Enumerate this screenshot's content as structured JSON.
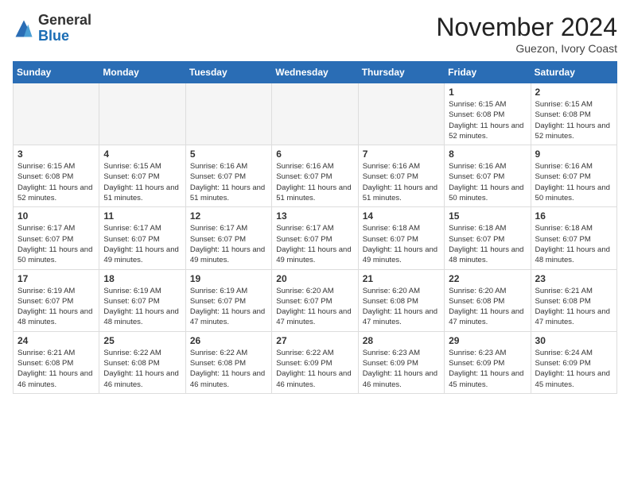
{
  "header": {
    "logo_general": "General",
    "logo_blue": "Blue",
    "month_title": "November 2024",
    "subtitle": "Guezon, Ivory Coast"
  },
  "weekdays": [
    "Sunday",
    "Monday",
    "Tuesday",
    "Wednesday",
    "Thursday",
    "Friday",
    "Saturday"
  ],
  "weeks": [
    [
      {
        "day": "",
        "empty": true
      },
      {
        "day": "",
        "empty": true
      },
      {
        "day": "",
        "empty": true
      },
      {
        "day": "",
        "empty": true
      },
      {
        "day": "",
        "empty": true
      },
      {
        "day": "1",
        "sunrise": "Sunrise: 6:15 AM",
        "sunset": "Sunset: 6:08 PM",
        "daylight": "Daylight: 11 hours and 52 minutes."
      },
      {
        "day": "2",
        "sunrise": "Sunrise: 6:15 AM",
        "sunset": "Sunset: 6:08 PM",
        "daylight": "Daylight: 11 hours and 52 minutes."
      }
    ],
    [
      {
        "day": "3",
        "sunrise": "Sunrise: 6:15 AM",
        "sunset": "Sunset: 6:08 PM",
        "daylight": "Daylight: 11 hours and 52 minutes."
      },
      {
        "day": "4",
        "sunrise": "Sunrise: 6:15 AM",
        "sunset": "Sunset: 6:07 PM",
        "daylight": "Daylight: 11 hours and 51 minutes."
      },
      {
        "day": "5",
        "sunrise": "Sunrise: 6:16 AM",
        "sunset": "Sunset: 6:07 PM",
        "daylight": "Daylight: 11 hours and 51 minutes."
      },
      {
        "day": "6",
        "sunrise": "Sunrise: 6:16 AM",
        "sunset": "Sunset: 6:07 PM",
        "daylight": "Daylight: 11 hours and 51 minutes."
      },
      {
        "day": "7",
        "sunrise": "Sunrise: 6:16 AM",
        "sunset": "Sunset: 6:07 PM",
        "daylight": "Daylight: 11 hours and 51 minutes."
      },
      {
        "day": "8",
        "sunrise": "Sunrise: 6:16 AM",
        "sunset": "Sunset: 6:07 PM",
        "daylight": "Daylight: 11 hours and 50 minutes."
      },
      {
        "day": "9",
        "sunrise": "Sunrise: 6:16 AM",
        "sunset": "Sunset: 6:07 PM",
        "daylight": "Daylight: 11 hours and 50 minutes."
      }
    ],
    [
      {
        "day": "10",
        "sunrise": "Sunrise: 6:17 AM",
        "sunset": "Sunset: 6:07 PM",
        "daylight": "Daylight: 11 hours and 50 minutes."
      },
      {
        "day": "11",
        "sunrise": "Sunrise: 6:17 AM",
        "sunset": "Sunset: 6:07 PM",
        "daylight": "Daylight: 11 hours and 49 minutes."
      },
      {
        "day": "12",
        "sunrise": "Sunrise: 6:17 AM",
        "sunset": "Sunset: 6:07 PM",
        "daylight": "Daylight: 11 hours and 49 minutes."
      },
      {
        "day": "13",
        "sunrise": "Sunrise: 6:17 AM",
        "sunset": "Sunset: 6:07 PM",
        "daylight": "Daylight: 11 hours and 49 minutes."
      },
      {
        "day": "14",
        "sunrise": "Sunrise: 6:18 AM",
        "sunset": "Sunset: 6:07 PM",
        "daylight": "Daylight: 11 hours and 49 minutes."
      },
      {
        "day": "15",
        "sunrise": "Sunrise: 6:18 AM",
        "sunset": "Sunset: 6:07 PM",
        "daylight": "Daylight: 11 hours and 48 minutes."
      },
      {
        "day": "16",
        "sunrise": "Sunrise: 6:18 AM",
        "sunset": "Sunset: 6:07 PM",
        "daylight": "Daylight: 11 hours and 48 minutes."
      }
    ],
    [
      {
        "day": "17",
        "sunrise": "Sunrise: 6:19 AM",
        "sunset": "Sunset: 6:07 PM",
        "daylight": "Daylight: 11 hours and 48 minutes."
      },
      {
        "day": "18",
        "sunrise": "Sunrise: 6:19 AM",
        "sunset": "Sunset: 6:07 PM",
        "daylight": "Daylight: 11 hours and 48 minutes."
      },
      {
        "day": "19",
        "sunrise": "Sunrise: 6:19 AM",
        "sunset": "Sunset: 6:07 PM",
        "daylight": "Daylight: 11 hours and 47 minutes."
      },
      {
        "day": "20",
        "sunrise": "Sunrise: 6:20 AM",
        "sunset": "Sunset: 6:07 PM",
        "daylight": "Daylight: 11 hours and 47 minutes."
      },
      {
        "day": "21",
        "sunrise": "Sunrise: 6:20 AM",
        "sunset": "Sunset: 6:08 PM",
        "daylight": "Daylight: 11 hours and 47 minutes."
      },
      {
        "day": "22",
        "sunrise": "Sunrise: 6:20 AM",
        "sunset": "Sunset: 6:08 PM",
        "daylight": "Daylight: 11 hours and 47 minutes."
      },
      {
        "day": "23",
        "sunrise": "Sunrise: 6:21 AM",
        "sunset": "Sunset: 6:08 PM",
        "daylight": "Daylight: 11 hours and 47 minutes."
      }
    ],
    [
      {
        "day": "24",
        "sunrise": "Sunrise: 6:21 AM",
        "sunset": "Sunset: 6:08 PM",
        "daylight": "Daylight: 11 hours and 46 minutes."
      },
      {
        "day": "25",
        "sunrise": "Sunrise: 6:22 AM",
        "sunset": "Sunset: 6:08 PM",
        "daylight": "Daylight: 11 hours and 46 minutes."
      },
      {
        "day": "26",
        "sunrise": "Sunrise: 6:22 AM",
        "sunset": "Sunset: 6:08 PM",
        "daylight": "Daylight: 11 hours and 46 minutes."
      },
      {
        "day": "27",
        "sunrise": "Sunrise: 6:22 AM",
        "sunset": "Sunset: 6:09 PM",
        "daylight": "Daylight: 11 hours and 46 minutes."
      },
      {
        "day": "28",
        "sunrise": "Sunrise: 6:23 AM",
        "sunset": "Sunset: 6:09 PM",
        "daylight": "Daylight: 11 hours and 46 minutes."
      },
      {
        "day": "29",
        "sunrise": "Sunrise: 6:23 AM",
        "sunset": "Sunset: 6:09 PM",
        "daylight": "Daylight: 11 hours and 45 minutes."
      },
      {
        "day": "30",
        "sunrise": "Sunrise: 6:24 AM",
        "sunset": "Sunset: 6:09 PM",
        "daylight": "Daylight: 11 hours and 45 minutes."
      }
    ]
  ]
}
